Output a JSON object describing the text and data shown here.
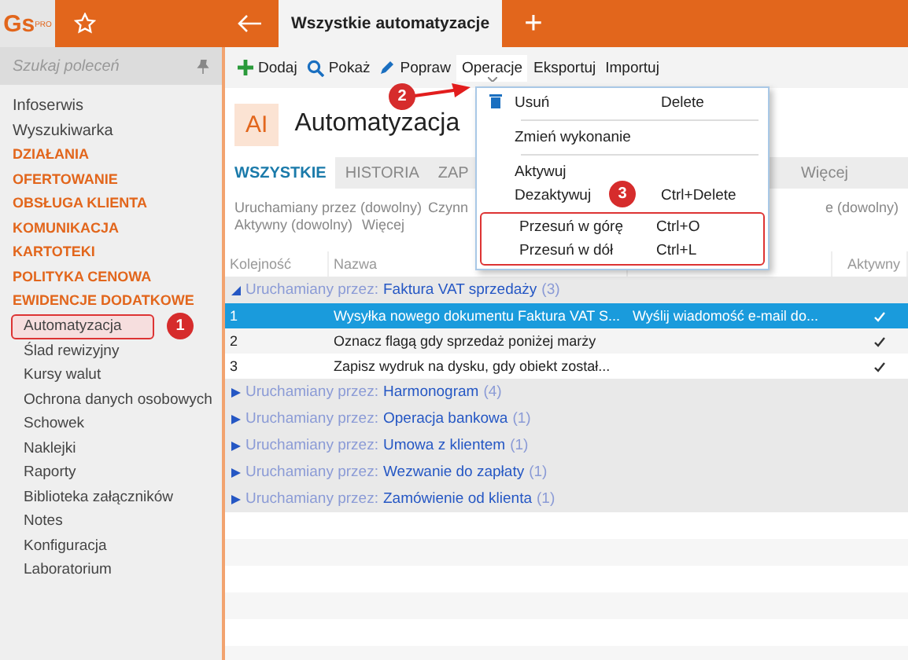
{
  "logo": {
    "text": "Gs",
    "badge": "PRO"
  },
  "doc_tab": {
    "title": "Wszystkie automatyzacje"
  },
  "new_tab": {
    "label": "+"
  },
  "sidebar": {
    "search": {
      "placeholder": "Szukaj poleceń"
    },
    "items": [
      {
        "label": "Infoserwis",
        "kind": "link",
        "selected": false
      },
      {
        "label": "Wyszukiwarka",
        "kind": "link",
        "selected": false
      },
      {
        "label": "DZIAŁANIA",
        "kind": "section",
        "selected": false
      },
      {
        "label": "OFERTOWANIE",
        "kind": "section",
        "selected": false
      },
      {
        "label": "OBSŁUGA KLIENTA",
        "kind": "section",
        "selected": false
      },
      {
        "label": "KOMUNIKACJA",
        "kind": "section",
        "selected": false
      },
      {
        "label": "KARTOTEKI",
        "kind": "section",
        "selected": false
      },
      {
        "label": "POLITYKA CENOWA",
        "kind": "section",
        "selected": false
      },
      {
        "label": "EWIDENCJE DODATKOWE",
        "kind": "section",
        "selected": false
      },
      {
        "label": "Automatyzacja",
        "kind": "sub",
        "selected": true
      },
      {
        "label": "Ślad rewizyjny",
        "kind": "sub",
        "selected": false
      },
      {
        "label": "Kursy walut",
        "kind": "sub",
        "selected": false
      },
      {
        "label": "Ochrona danych osobowych",
        "kind": "sub",
        "selected": false
      },
      {
        "label": "Schowek",
        "kind": "sub",
        "selected": false
      },
      {
        "label": "Naklejki",
        "kind": "sub",
        "selected": false
      },
      {
        "label": "Raporty",
        "kind": "sub",
        "selected": false
      },
      {
        "label": "Biblioteka załączników",
        "kind": "sub",
        "selected": false
      },
      {
        "label": "Notes",
        "kind": "sub",
        "selected": false
      },
      {
        "label": "Konfiguracja",
        "kind": "sub",
        "selected": false
      },
      {
        "label": "Laboratorium",
        "kind": "sub",
        "selected": false
      }
    ]
  },
  "toolbar": [
    {
      "label": "Dodaj",
      "kind": "add",
      "selected": false
    },
    {
      "label": "Pokaż",
      "kind": "search",
      "selected": false
    },
    {
      "label": "Popraw",
      "kind": "edit",
      "selected": false
    },
    {
      "label": "Operacje",
      "kind": "menu",
      "selected": true
    },
    {
      "label": "Eksportuj",
      "kind": "plain",
      "selected": false
    },
    {
      "label": "Importuj",
      "kind": "plain",
      "selected": false
    }
  ],
  "header": {
    "badge": "AI",
    "title": "Automatyzacja"
  },
  "tabs": [
    {
      "label": "WSZYSTKIE",
      "selected": true
    },
    {
      "label": "HISTORIA",
      "selected": false
    },
    {
      "label": "ZAP",
      "selected": false
    }
  ],
  "more_tab": "Więcej",
  "filters": {
    "left": [
      "Uruchamiany przez (dowolny)",
      "Czynn"
    ],
    "right": "e (dowolny)",
    "second": [
      "Aktywny (dowolny)",
      "Więcej"
    ]
  },
  "table": {
    "columns": [
      "Kolejność",
      "Nazwa",
      "Aktywny"
    ],
    "groups": [
      {
        "prefix": "Uruchamiany przez:",
        "value": "Faktura VAT sprzedaży",
        "count": "(3)",
        "expanded": true,
        "rows": [
          {
            "order": "1",
            "name": "Wysyłka nowego dokumentu Faktura VAT S...",
            "action": "Wyślij wiadomość e-mail do...",
            "active": true,
            "selected": true
          },
          {
            "order": "2",
            "name": "Oznacz flagą gdy sprzedaż poniżej marży",
            "active": true,
            "selected": false
          },
          {
            "order": "3",
            "name": "Zapisz wydruk na dysku, gdy obiekt został...",
            "active": true,
            "selected": false
          }
        ]
      },
      {
        "prefix": "Uruchamiany przez:",
        "value": "Harmonogram",
        "count": "(4)",
        "expanded": false
      },
      {
        "prefix": "Uruchamiany przez:",
        "value": "Operacja bankowa",
        "count": "(1)",
        "expanded": false
      },
      {
        "prefix": "Uruchamiany przez:",
        "value": "Umowa z klientem",
        "count": "(1)",
        "expanded": false
      },
      {
        "prefix": "Uruchamiany przez:",
        "value": "Wezwanie do zapłaty",
        "count": "(1)",
        "expanded": false
      },
      {
        "prefix": "Uruchamiany przez:",
        "value": "Zamówienie od klienta",
        "count": "(1)",
        "expanded": false
      }
    ]
  },
  "menu": {
    "sections": [
      [
        {
          "label": "Usuń",
          "shortcut": "Delete",
          "kind": "delete"
        }
      ],
      [
        {
          "label": "Zmień wykonanie",
          "kind": "plain"
        }
      ],
      [
        {
          "label": "Aktywuj",
          "kind": "plain"
        },
        {
          "label": "Dezaktywuj",
          "shortcut": "Ctrl+Delete",
          "kind": "plain"
        }
      ],
      [
        {
          "label": "Przesuń w górę",
          "shortcut": "Ctrl+O",
          "kind": "plain"
        },
        {
          "label": "Przesuń w dół",
          "shortcut": "Ctrl+L",
          "kind": "plain"
        }
      ]
    ]
  },
  "callouts": [
    "1",
    "2",
    "3"
  ]
}
